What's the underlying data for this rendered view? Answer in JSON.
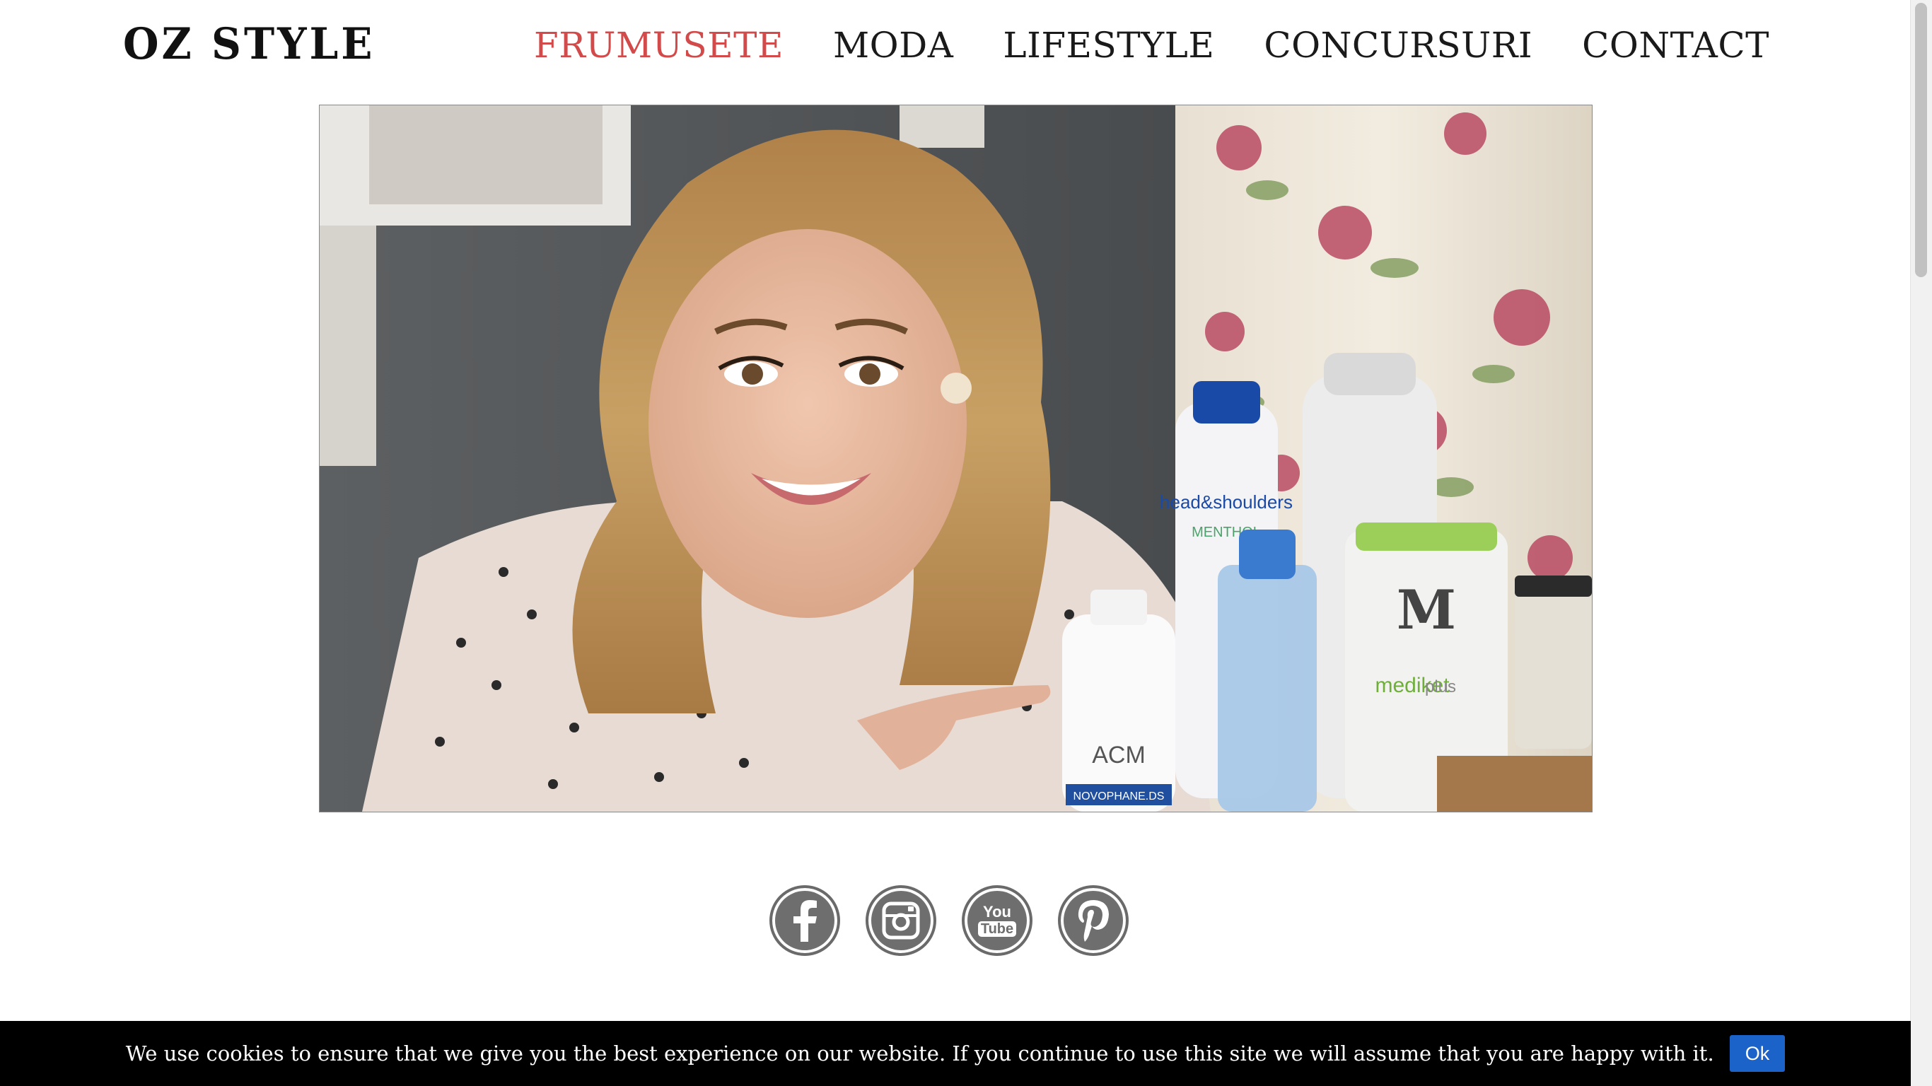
{
  "header": {
    "logo": "OZ STYLE",
    "nav": [
      {
        "label": "FRUMUSETE",
        "active": true
      },
      {
        "label": "MODA",
        "active": false
      },
      {
        "label": "LIFESTYLE",
        "active": false
      },
      {
        "label": "CONCURSURI",
        "active": false
      },
      {
        "label": "CONTACT",
        "active": false
      }
    ],
    "active_color": "#d24a4a"
  },
  "hero": {
    "product_labels": {
      "shampoo_brand": "head&shoulders",
      "shampoo_variant": "MENTHOL",
      "acm_brand": "ACM",
      "acm_product": "NOVOPHANE.DS",
      "mediket_letter": "M",
      "mediket_name": "mediket",
      "mediket_variant": "plus"
    }
  },
  "social": {
    "icons": [
      "facebook-icon",
      "instagram-icon",
      "youtube-icon",
      "pinterest-icon"
    ],
    "youtube_line1": "You",
    "youtube_line2": "Tube"
  },
  "cookie_bar": {
    "text": "We use cookies to ensure that we give you the best experience on our website. If you continue to use this site we will assume that you are happy with it.",
    "ok_label": "Ok",
    "button_color": "#1b63c9"
  }
}
